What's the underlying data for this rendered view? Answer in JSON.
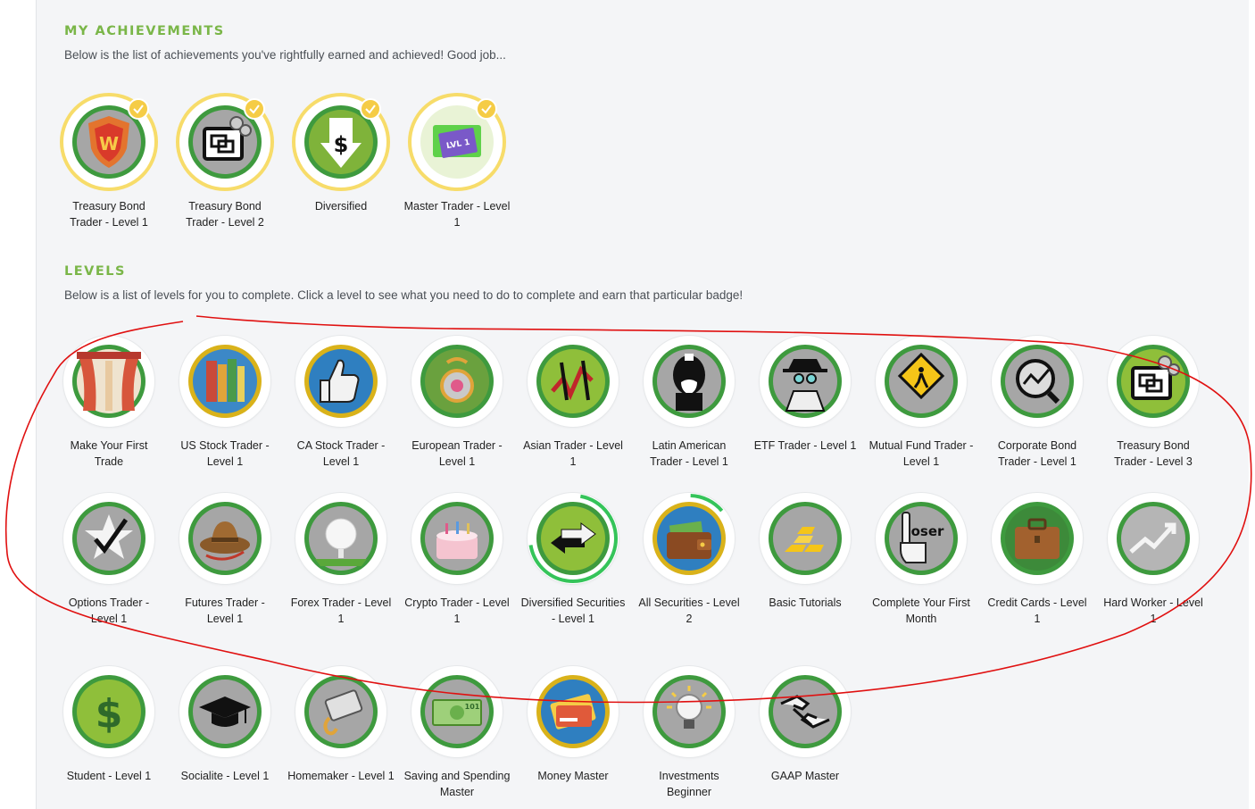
{
  "achievements": {
    "title": "MY ACHIEVEMENTS",
    "description": "Below is the list of achievements you've rightfully earned and achieved! Good job...",
    "items": [
      {
        "label": "Treasury Bond Trader - Level 1",
        "icon": "shield-icon"
      },
      {
        "label": "Treasury Bond Trader - Level 2",
        "icon": "screen-icon"
      },
      {
        "label": "Diversified",
        "icon": "dollar-arrow-icon"
      },
      {
        "label": "Master Trader - Level 1",
        "icon": "trader-card-icon"
      }
    ]
  },
  "levels": {
    "title": "LEVELS",
    "description": "Below is a list of levels for you to complete. Click a level to see what you need to do to complete and earn that particular badge!",
    "items": [
      {
        "label": "Make Your First Trade",
        "icon": "curtain-icon",
        "color": "#c96a4a"
      },
      {
        "label": "US Stock Trader - Level 1",
        "icon": "books-icon",
        "color": "#3c88c7"
      },
      {
        "label": "CA Stock Trader - Level 1",
        "icon": "thumbs-up-icon",
        "color": "#2f7fc0"
      },
      {
        "label": "European Trader - Level 1",
        "icon": "medal-icon",
        "color": "#5a9a3a"
      },
      {
        "label": "Asian Trader - Level 1",
        "icon": "tools-icon",
        "color": "#7fb33a"
      },
      {
        "label": "Latin American Trader - Level 1",
        "icon": "mascot-icon",
        "color": "#999999"
      },
      {
        "label": "ETF Trader - Level 1",
        "icon": "spy-icon",
        "color": "#9a9a9a"
      },
      {
        "label": "Mutual Fund Trader - Level 1",
        "icon": "warning-sign-icon",
        "color": "#9a9a9a"
      },
      {
        "label": "Corporate Bond Trader - Level 1",
        "icon": "magnifier-chart-icon",
        "color": "#9a9a9a"
      },
      {
        "label": "Treasury Bond Trader - Level 3",
        "icon": "screen-icon",
        "color": "#7fb33a"
      },
      {
        "label": "Options Trader - Level 1",
        "icon": "star-check-icon",
        "color": "#9a9a9a"
      },
      {
        "label": "Futures Trader - Level 1",
        "icon": "hat-icon",
        "color": "#9a9a9a"
      },
      {
        "label": "Forex Trader - Level 1",
        "icon": "golf-ball-icon",
        "color": "#9a9a9a"
      },
      {
        "label": "Crypto Trader - Level 1",
        "icon": "cake-icon",
        "color": "#9a9a9a"
      },
      {
        "label": "Diversified Securities - Level 1",
        "icon": "arrows-icon",
        "color": "#7fb33a"
      },
      {
        "label": "All Securities - Level 2",
        "icon": "wallet-icon",
        "color": "#2f7fc0"
      },
      {
        "label": "Basic Tutorials",
        "icon": "gold-bars-icon",
        "color": "#9a9a9a"
      },
      {
        "label": "Complete Your First Month",
        "icon": "loser-hand-icon",
        "color": "#9a9a9a"
      },
      {
        "label": "Credit Cards - Level 1",
        "icon": "briefcase-icon",
        "color": "#3d8a3a"
      },
      {
        "label": "Hard Worker - Level 1",
        "icon": "trend-up-icon",
        "color": "#9a9a9a"
      },
      {
        "label": "Student - Level 1",
        "icon": "dollar-plant-icon",
        "color": "#7fb33a"
      },
      {
        "label": "Socialite - Level 1",
        "icon": "grad-cap-icon",
        "color": "#9a9a9a"
      },
      {
        "label": "Homemaker - Level 1",
        "icon": "card-hook-icon",
        "color": "#9a9a9a"
      },
      {
        "label": "Saving and Spending Master",
        "icon": "banknote-icon",
        "color": "#9a9a9a"
      },
      {
        "label": "Money Master",
        "icon": "credit-card-icon",
        "color": "#2f7fc0"
      },
      {
        "label": "Investments Beginner",
        "icon": "lightbulb-icon",
        "color": "#9a9a9a"
      },
      {
        "label": "GAAP Master",
        "icon": "handshake-icon",
        "color": "#9a9a9a"
      }
    ]
  },
  "colors": {
    "accent_green": "#7ab648",
    "earned_ring": "#f7dc6a",
    "check_badge": "#f5cc46",
    "badge_border_green": "#3e9a3e",
    "progress_green": "#35c45a",
    "annotation_red": "#e01010"
  }
}
